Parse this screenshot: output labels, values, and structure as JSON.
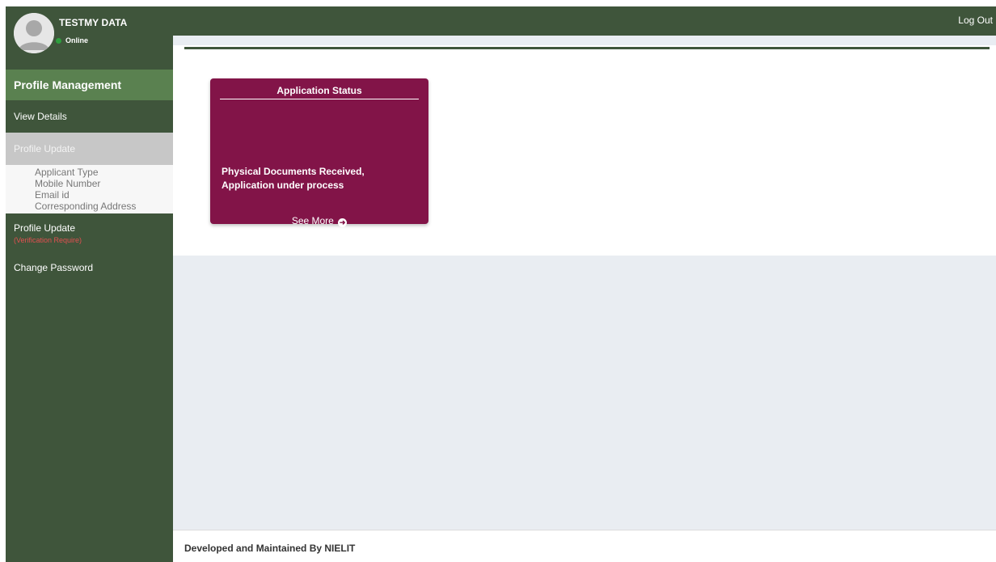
{
  "user": {
    "name": "TESTMY DATA",
    "status": "Online"
  },
  "sidebar": {
    "section_title": "Profile Management",
    "items": [
      {
        "label": "View Details"
      },
      {
        "label": "Profile Update",
        "active": true,
        "sub_items": [
          "Applicant Type",
          "Mobile Number",
          "Email id",
          "Corresponding Address"
        ]
      },
      {
        "label": "Profile Update",
        "note": "(Verification Require)"
      },
      {
        "label": "Change Password"
      }
    ]
  },
  "header": {
    "logout_label": "Log Out"
  },
  "status_card": {
    "title": "Application Status",
    "message": "Physical Documents Received, Application under process",
    "see_more_label": "See More",
    "icon": "arrow-circle-right-icon"
  },
  "footer": {
    "text": "Developed and Maintained By NIELIT"
  },
  "colors": {
    "sidebar_bg": "#3f553b",
    "section_header_bg": "#5a8150",
    "card_bg": "#821448",
    "active_item_bg": "#c7c7c7",
    "warning_text": "#e25050"
  }
}
